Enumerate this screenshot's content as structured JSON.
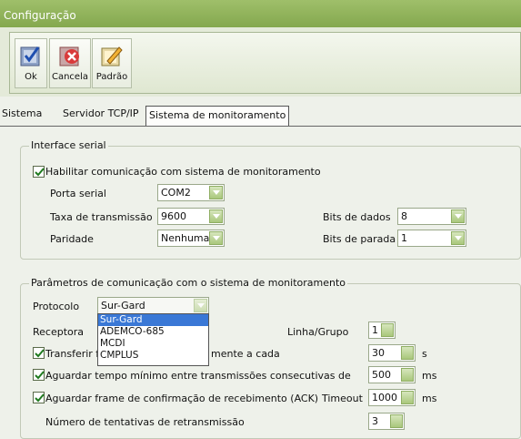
{
  "window": {
    "title": "Configuração"
  },
  "toolbar": {
    "ok_label": "Ok",
    "cancel_label": "Cancela",
    "default_label": "Padrão"
  },
  "tabs": [
    {
      "label": "Sistema"
    },
    {
      "label": "Servidor TCP/IP"
    },
    {
      "label": "Sistema de monitoramento"
    }
  ],
  "serial": {
    "legend": "Interface serial",
    "enable_label": "Habilitar comunicação com sistema de monitoramento",
    "port_label": "Porta serial",
    "port_value": "COM2",
    "baud_label": "Taxa de transmissão",
    "baud_value": "9600",
    "databits_label": "Bits de dados",
    "databits_value": "8",
    "parity_label": "Paridade",
    "parity_value": "Nenhuma",
    "stopbits_label": "Bits de parada",
    "stopbits_value": "1"
  },
  "params": {
    "legend": "Parâmetros de comunicação com o sistema de monitoramento",
    "protocol_label": "Protocolo",
    "protocol_value": "Sur-Gard",
    "protocol_options": [
      "Sur-Gard",
      "ADEMCO-685",
      "MCDI",
      "CMPLUS"
    ],
    "receiver_label": "Receptora",
    "line_group_label": "Linha/Grupo",
    "line_group_value": "1",
    "transfer_label_left": "Transferir fr",
    "transfer_label_right": "mente a cada",
    "transfer_value": "30",
    "transfer_unit": "s",
    "min_wait_label": "Aguardar tempo mínimo entre transmissões consecutivas de",
    "min_wait_value": "500",
    "min_wait_unit": "ms",
    "ack_label": "Aguardar frame de confirmação de recebimento (ACK)",
    "timeout_label": "Timeout",
    "timeout_value": "1000",
    "timeout_unit": "ms",
    "retries_label": "Número de tentativas de retransmissão",
    "retries_value": "3"
  }
}
